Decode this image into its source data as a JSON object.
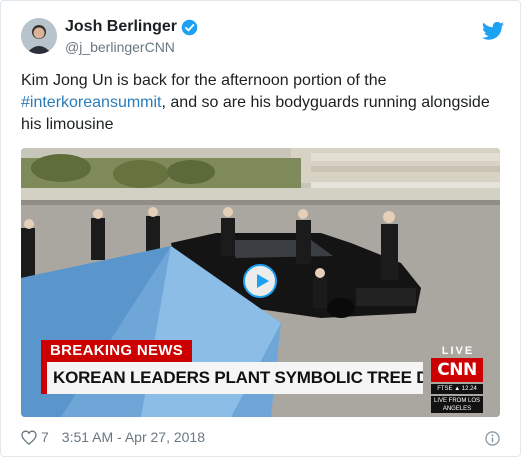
{
  "author": {
    "name": "Josh Berlinger",
    "handle": "@j_berlingerCNN"
  },
  "tweet": {
    "text_before": "Kim Jong Un is back for the afternoon portion of the ",
    "hashtag": "#interkoreansummit",
    "text_after": ", and so are his bodyguards running alongside his limousine"
  },
  "media": {
    "breaking_label": "BREAKING NEWS",
    "headline": "KOREAN LEADERS PLANT SYMBOLIC TREE DURING SUMMIT",
    "live_label": "LIVE",
    "network_logo": "CNN",
    "ticker": "FTSE ▲ 12.24",
    "location": "LIVE FROM LOS ANGELES"
  },
  "footer": {
    "likes": "7",
    "timestamp": "3:51 AM - Apr 27, 2018"
  },
  "icons": {
    "twitter_bird": "twitter-bird-icon",
    "verified": "verified-badge-icon",
    "like": "heart-icon",
    "info": "info-icon",
    "play": "play-icon"
  },
  "colors": {
    "brand": "#1da1f2",
    "hashtag": "#2b7bb9",
    "secondary_text": "#697882",
    "cnn_red": "#cc0000"
  }
}
